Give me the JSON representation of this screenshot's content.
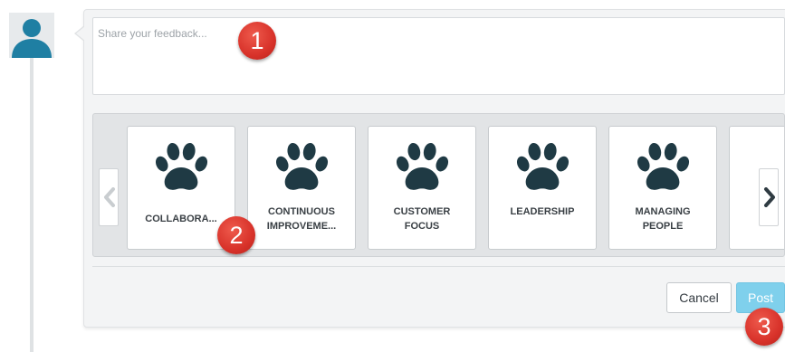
{
  "feedback": {
    "placeholder": "Share your feedback..."
  },
  "values": [
    {
      "label": "COLLABORA...",
      "icon": "paw-icon"
    },
    {
      "label": "CONTINUOUS\nIMPROVEME...",
      "icon": "paw-icon"
    },
    {
      "label": "CUSTOMER\nFOCUS",
      "icon": "paw-icon"
    },
    {
      "label": "LEADERSHIP",
      "icon": "paw-icon"
    },
    {
      "label": "MANAGING\nPEOPLE",
      "icon": "paw-icon"
    }
  ],
  "carousel": {
    "prev_icon": "chevron-left-icon",
    "next_icon": "chevron-right-icon"
  },
  "actions": {
    "cancel_label": "Cancel",
    "post_label": "Post"
  },
  "markers": [
    "1",
    "2",
    "3"
  ],
  "colors": {
    "accent": "#7fd0ec",
    "avatar": "#1f7fa3",
    "paw": "#1f3a44",
    "marker": "#d8322a"
  }
}
